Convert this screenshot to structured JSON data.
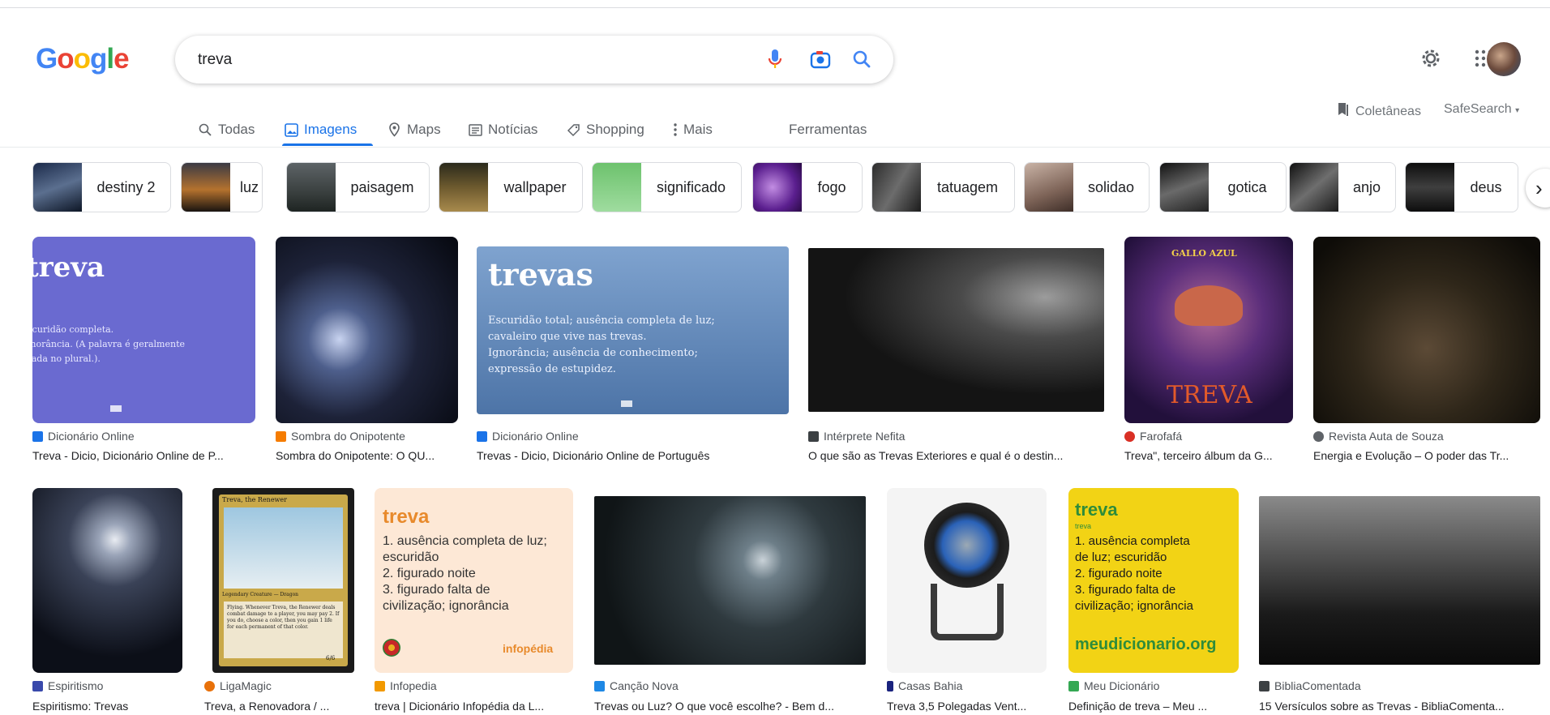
{
  "logo": {
    "letters": [
      "G",
      "o",
      "o",
      "g",
      "l",
      "e"
    ],
    "colors": [
      "#4285f4",
      "#ea4335",
      "#fbbc05",
      "#4285f4",
      "#34a853",
      "#ea4335"
    ]
  },
  "search": {
    "query": "treva"
  },
  "tabs": [
    {
      "label": "Todas",
      "icon": "search-icon"
    },
    {
      "label": "Imagens",
      "icon": "image-icon",
      "active": true
    },
    {
      "label": "Maps",
      "icon": "map-pin-icon"
    },
    {
      "label": "Notícias",
      "icon": "news-icon"
    },
    {
      "label": "Shopping",
      "icon": "tag-icon"
    },
    {
      "label": "Mais",
      "icon": "more-vert-icon"
    }
  ],
  "tools_label": "Ferramentas",
  "colecoes_label": "Coletâneas",
  "safesearch_label": "SafeSearch",
  "chips": [
    "destiny 2",
    "luz",
    "paisagem",
    "wallpaper",
    "significado",
    "fogo",
    "tatuagem",
    "solidao",
    "gotica",
    "anjo",
    "deus"
  ],
  "row1": [
    {
      "source": "Dicionário Online",
      "title": "Treva - Dicio, Dicionário Online de P...",
      "fav_color": "#1a73e8",
      "img": {
        "heading": "treva",
        "lines": [
          "Escuridão completa.",
          "Ignorância. (A palavra é geralmente",
          "usada no plural.)."
        ]
      }
    },
    {
      "source": "Sombra do Onipotente",
      "title": "Sombra do Onipotente: O QU...",
      "fav_color": "#f57c00"
    },
    {
      "source": "Dicionário Online",
      "title": "Trevas - Dicio, Dicionário Online de Português",
      "fav_color": "#1a73e8",
      "img": {
        "heading": "trevas",
        "lines": [
          "Escuridão total; ausência completa de luz;",
          "cavaleiro que vive nas trevas.",
          "Ignorância; ausência de conhecimento;",
          "expressão de estupidez."
        ]
      }
    },
    {
      "source": "Intérprete Nefita",
      "title": "O que são as Trevas Exteriores e qual é o destin...",
      "fav_color": "#3c4043"
    },
    {
      "source": "Farofafá",
      "title": "Treva\", terceiro álbum da G...",
      "fav_color": "#d93025",
      "img": {
        "top": "GALLO AZUL",
        "bottom": "TREVA"
      }
    },
    {
      "source": "Revista Auta de Souza",
      "title": "Energia e Evolução – O poder das Tr...",
      "fav_color": "#5f6368"
    }
  ],
  "row2": [
    {
      "source": "Espiritismo",
      "title": "Espiritismo: Trevas",
      "fav_color": "#3949ab"
    },
    {
      "source": "LigaMagic",
      "title": "Treva, a Renovadora / ...",
      "fav_color": "#e8710a",
      "img": {
        "name": "Treva, the Renewer",
        "type": "Legendary Creature — Dragon",
        "text": "Flying. Whenever Treva, the Renewer deals combat damage to a player, you may pay 2. If you do, choose a color, then you gain 1 life for each permanent of that color.",
        "pt": "6/6"
      }
    },
    {
      "source": "Infopedia",
      "title": "treva | Dicionário Infopédia da L...",
      "fav_color": "#f29900",
      "img": {
        "heading": "treva",
        "lines": [
          "1. ausência completa de luz;",
          "escuridão",
          "2. figurado noite",
          "3. figurado falta de",
          "civilização; ignorância"
        ],
        "brand": "infopédia"
      }
    },
    {
      "source": "Canção Nova",
      "title": "Trevas ou Luz? O que você escolhe? - Bem d...",
      "fav_color": "#1e88e5"
    },
    {
      "source": "Casas Bahia",
      "title": "Treva 3,5 Polegadas Vent...",
      "fav_color": "#1a237e"
    },
    {
      "source": "Meu Dicionário",
      "title": "Definição de treva – Meu ...",
      "fav_color": "#34a853",
      "img": {
        "heading": "treva",
        "sub": "treva",
        "lines": [
          "1. ausência completa",
          "de luz; escuridão",
          "2. figurado noite",
          "3. figurado falta de",
          "civilização; ignorância"
        ],
        "brand": "meudicionario.org"
      }
    },
    {
      "source": "BibliaComentada",
      "title": "15 Versículos sobre as Trevas - BibliaComenta...",
      "fav_color": "#3c4043"
    }
  ]
}
